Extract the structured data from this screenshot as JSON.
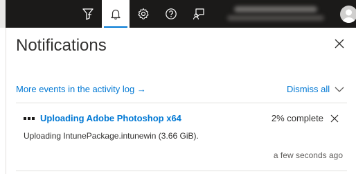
{
  "topbar": {
    "icons": [
      "portal-filter-icon",
      "bell-icon",
      "gear-icon",
      "help-icon",
      "feedback-icon"
    ],
    "active_icon": "bell-icon"
  },
  "panel": {
    "title": "Notifications",
    "activity_link": "More events in the activity log →",
    "dismiss_all": "Dismiss all"
  },
  "notifications": [
    {
      "title": "Uploading Adobe Photoshop x64",
      "status": "2% complete",
      "body": "Uploading IntunePackage.intunewin (3.66 GiB).",
      "time": "a few seconds ago"
    }
  ],
  "colors": {
    "topbar": "#1b1a19",
    "accent": "#0078d4",
    "text": "#323130",
    "divider": "#e1dfdd"
  }
}
